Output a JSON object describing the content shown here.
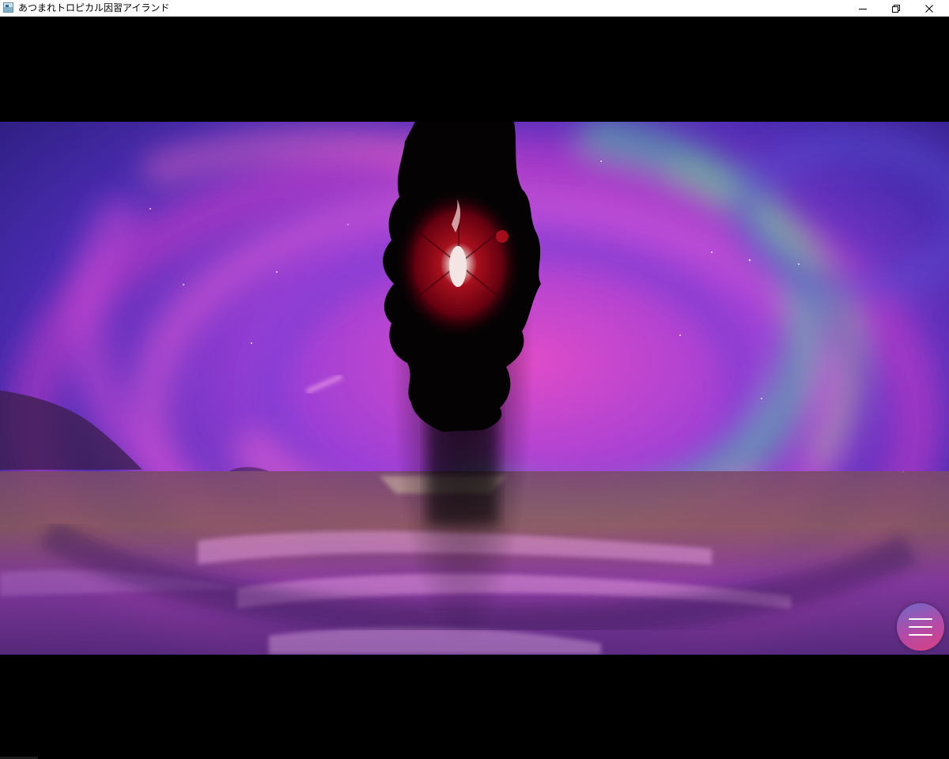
{
  "window": {
    "title": "あつまれトロピカル因習アイランド",
    "icon": "app-window-icon",
    "controls": [
      "minimize-icon",
      "restore-icon",
      "close-icon"
    ]
  },
  "scene": {
    "description_icons": [
      "black-tree-silhouette",
      "glowing-red-eye",
      "purple-sky-vortex",
      "ocean-waves"
    ],
    "colors": {
      "sky_purple": "#6a2fc4",
      "pink": "#e24fd0",
      "teal": "#3fb7a8",
      "eye_red": "#a0000e",
      "sea_gold": "#8a6a3a"
    }
  },
  "menu": {
    "icon": "hamburger-menu-icon"
  }
}
